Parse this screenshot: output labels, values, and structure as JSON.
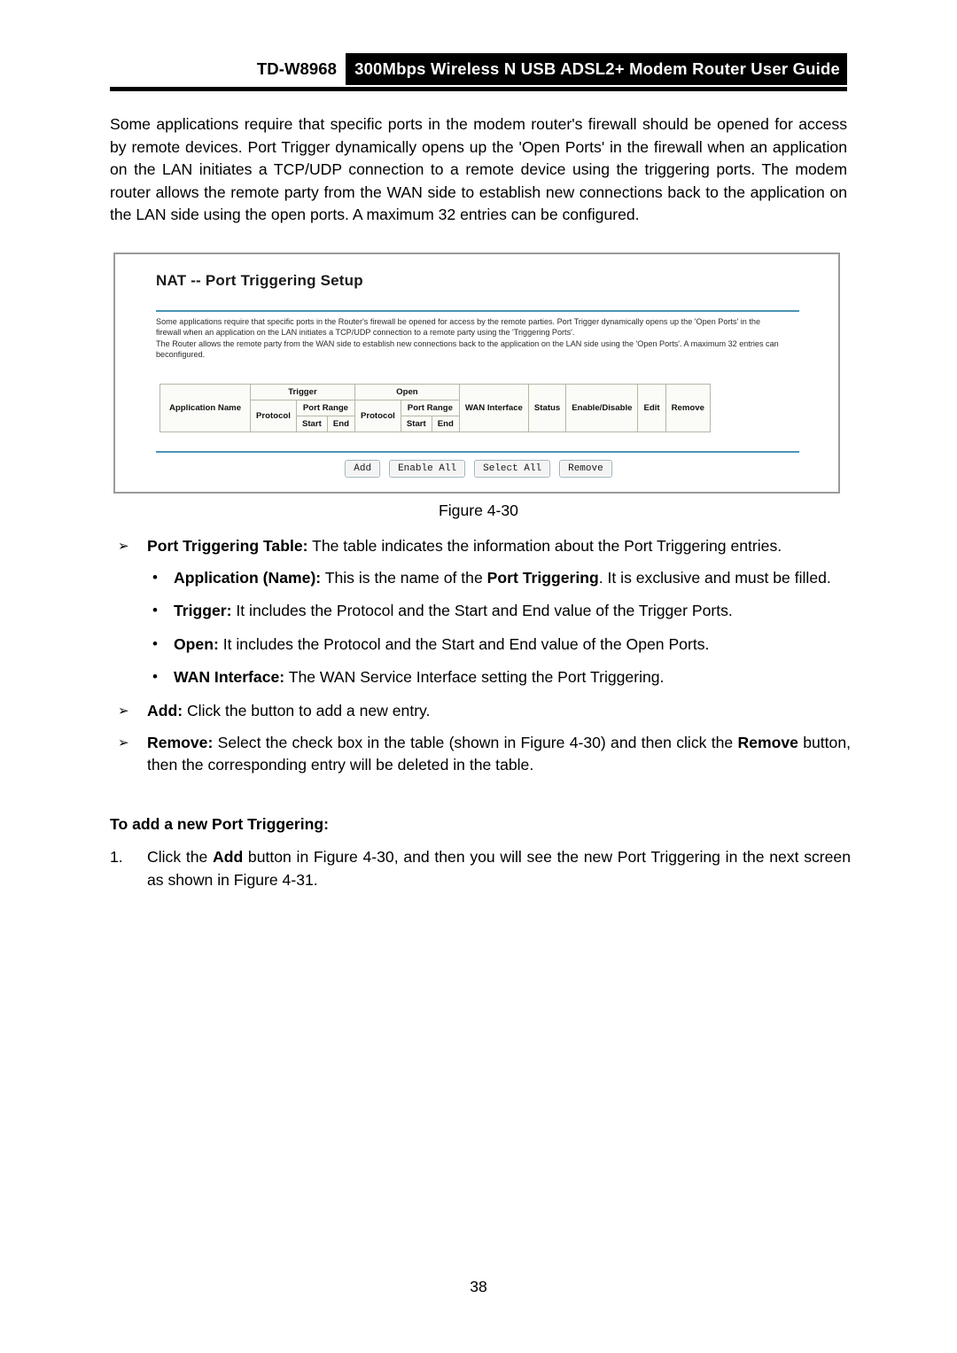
{
  "header": {
    "model": "TD-W8968",
    "title": "300Mbps Wireless N USB ADSL2+ Modem Router User Guide"
  },
  "intro": {
    "paragraph": "Some applications require that specific ports in the modem router's firewall should be opened for access by remote devices. Port Trigger dynamically opens up the 'Open Ports' in the firewall when an application on the LAN initiates a TCP/UDP connection to a remote device using the triggering ports. The modem router allows the remote party from the WAN side to establish new connections back to the application on the LAN side using the open ports. A maximum 32 entries can be configured."
  },
  "screenshot": {
    "title": "NAT -- Port Triggering Setup",
    "description_line1": "Some applications require that specific ports in the Router's firewall be opened for access by the remote parties. Port Trigger dynamically opens up the 'Open Ports' in the",
    "description_line2": "firewall when an application on the LAN initiates a TCP/UDP connection to a remote party using the 'Triggering Ports'.",
    "description_line3": "The Router allows the remote party from the WAN side to establish new connections back to the application on the LAN side using the 'Open Ports'. A maximum 32 entries can",
    "description_line4": "beconfigured.",
    "table": {
      "col_application_name": "Application Name",
      "group_trigger": "Trigger",
      "group_open": "Open",
      "trigger_protocol": "Protocol",
      "trigger_port_range": "Port Range",
      "trigger_start": "Start",
      "trigger_end": "End",
      "open_protocol": "Protocol",
      "open_port_range": "Port Range",
      "open_start": "Start",
      "open_end": "End",
      "col_wan_interface": "WAN Interface",
      "col_status": "Status",
      "col_enable_disable": "Enable/Disable",
      "col_edit": "Edit",
      "col_remove": "Remove",
      "rows": []
    },
    "buttons": [
      {
        "label": "Add"
      },
      {
        "label": "Enable All"
      },
      {
        "label": "Select All"
      },
      {
        "label": "Remove"
      }
    ],
    "accent_color": "#4a95b5",
    "border_color": "#9a9a9a"
  },
  "figure_caption": "Figure 4-30",
  "outline": {
    "item1": {
      "marker": "➢",
      "bold": "Port Triggering Table:",
      "rest": " The table indicates the information about the Port Triggering entries."
    },
    "sub1": {
      "marker": "•",
      "bold": "Application (Name):",
      "rest_a": " This is the name of the ",
      "bold_b": "Port Triggering",
      "rest_b": ". It is exclusive and must be filled."
    },
    "sub2": {
      "marker": "•",
      "bold": "Trigger:",
      "rest": " It includes the Protocol and the Start and End value of the Trigger Ports."
    },
    "sub3": {
      "marker": "•",
      "bold": "Open:",
      "rest": " It includes the Protocol and the Start and End value of the Open Ports."
    },
    "sub4": {
      "marker": "•",
      "bold": "WAN Interface:",
      "rest": " The WAN Service Interface setting the Port Triggering."
    },
    "item2": {
      "marker": "➢",
      "bold": "Add:",
      "rest": " Click the button to add a new entry."
    },
    "item3": {
      "marker": "➢",
      "bold": "Remove:",
      "rest_a": " Select the check box in the table (shown in Figure 4-30) and then click the ",
      "bold_b": "Remove",
      "rest_b": " button, then the corresponding entry will be deleted in the table."
    }
  },
  "subhead": "To add a new Port Triggering:",
  "numbered": {
    "marker": "1.",
    "rest_a": "Click the ",
    "bold_b": "Add",
    "rest_b": " button in Figure 4-30, and then you will see the new Port Triggering in the next screen as shown in Figure 4-31."
  },
  "page_number": "38"
}
